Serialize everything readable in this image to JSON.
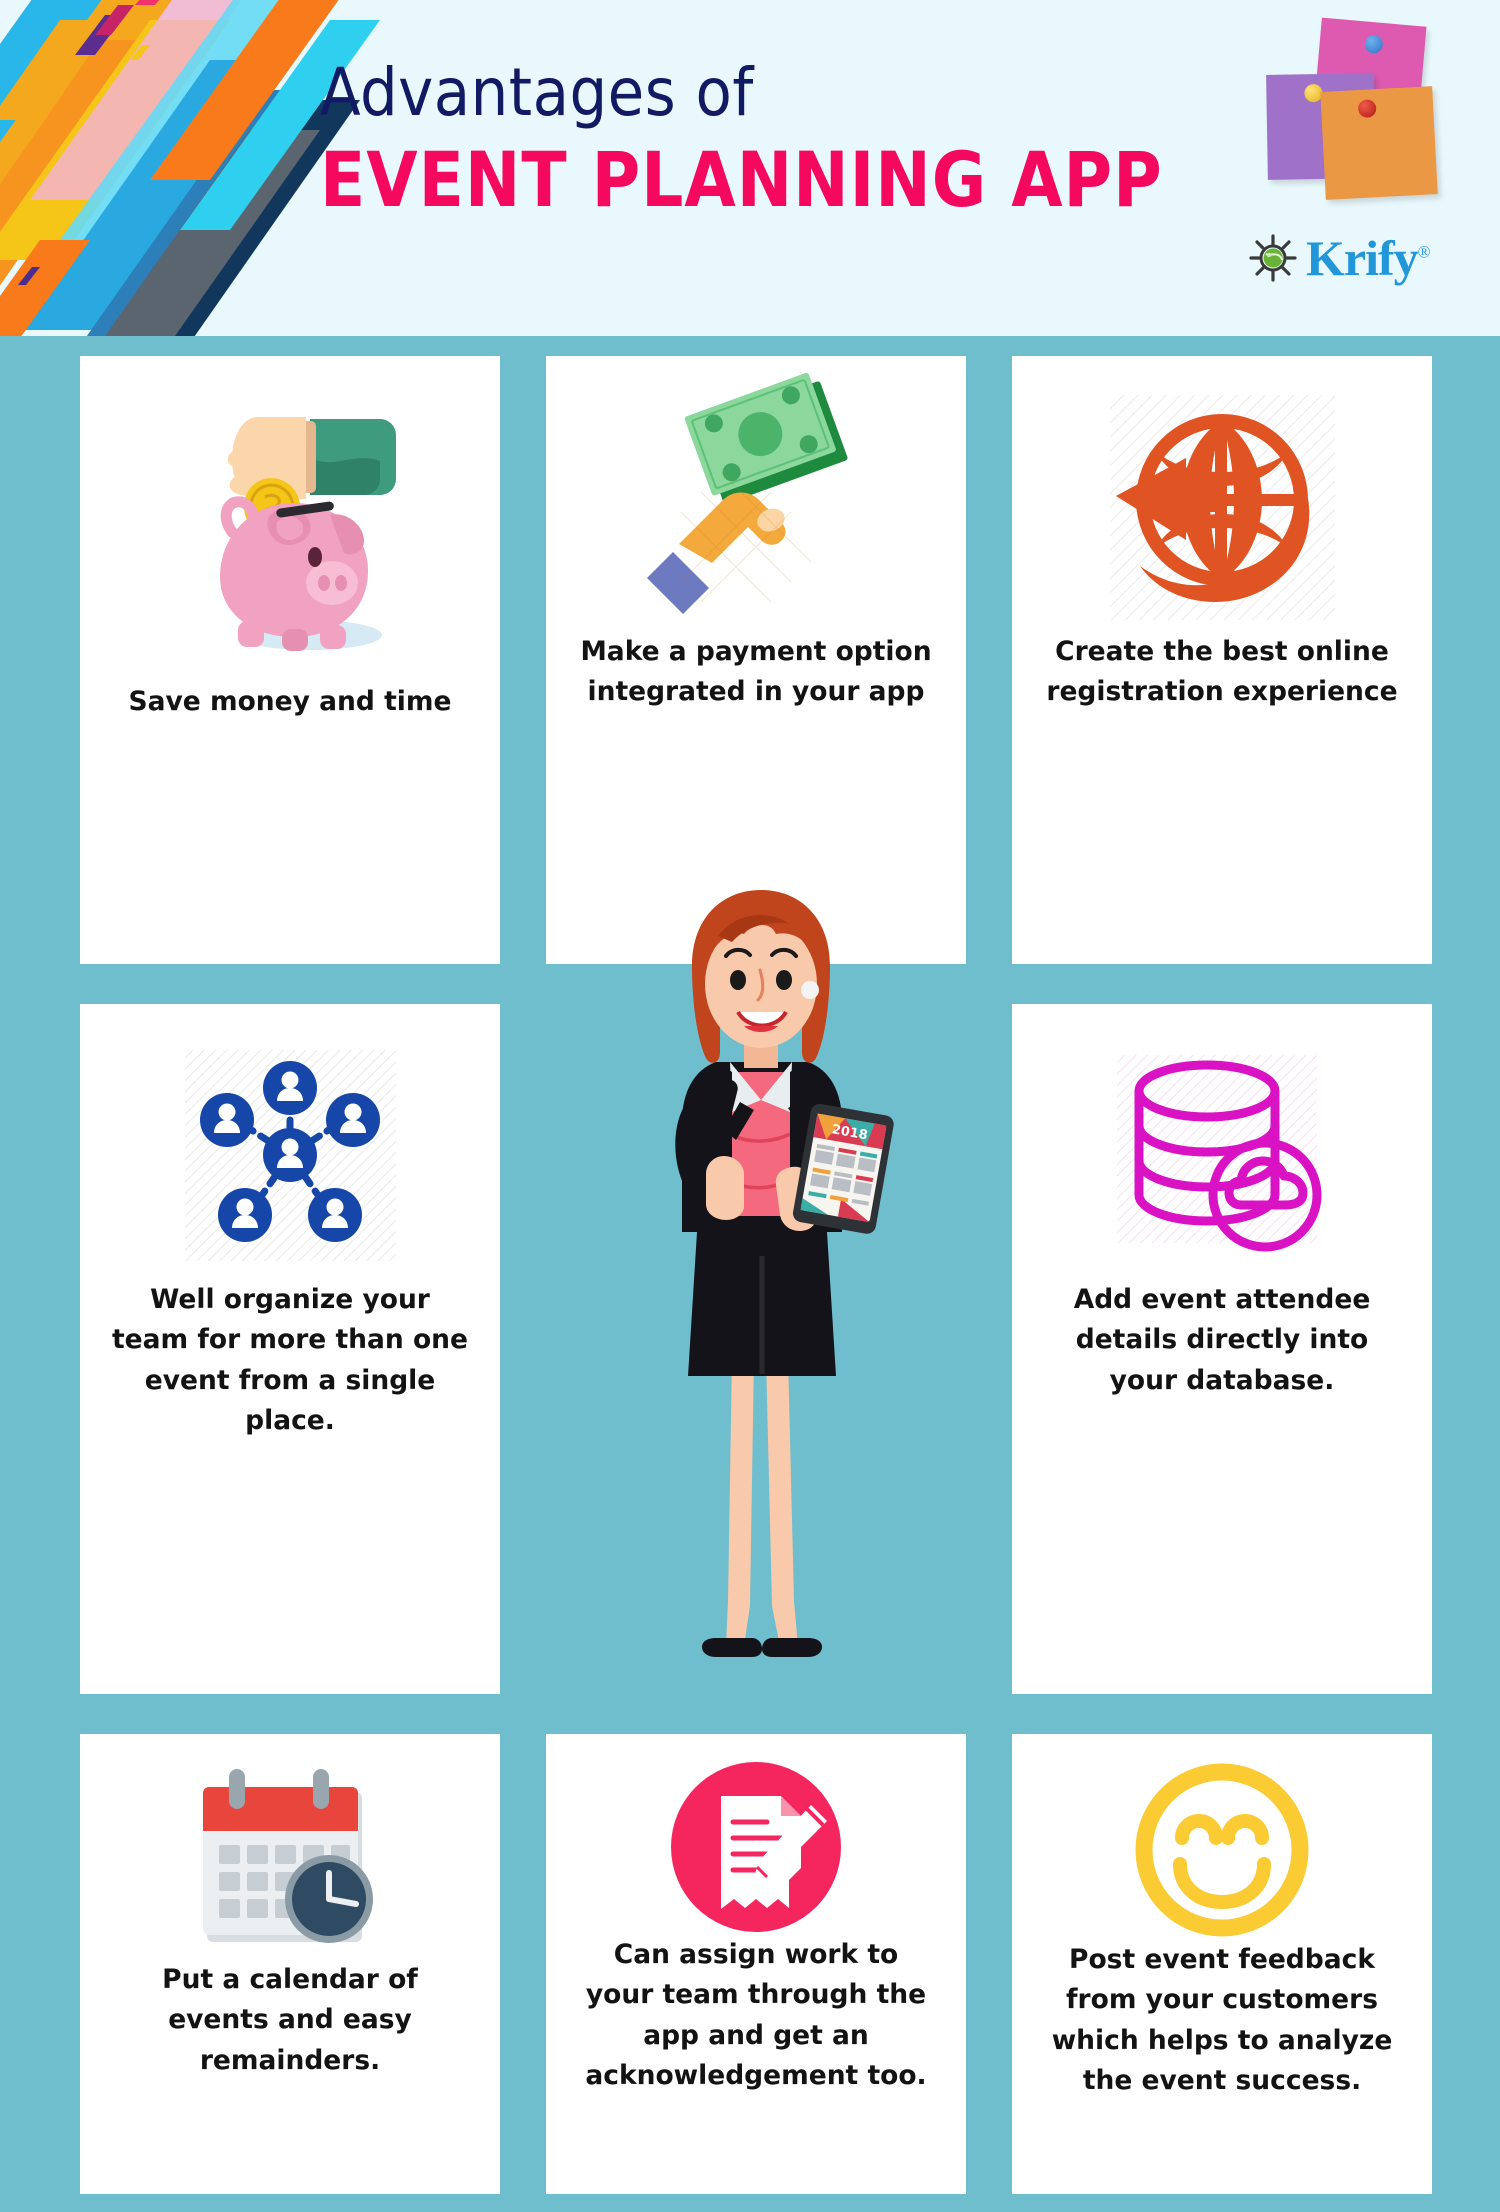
{
  "header": {
    "title_line1": "Advantages of",
    "title_line2": "EVENT PLANNING APP",
    "logo_text": "Krify",
    "logo_reg": "®",
    "colors": {
      "header_bg": "#e8f8fc",
      "title_line1": "#111a63",
      "title_line2": "#f5095e",
      "logo": "#2196d8"
    },
    "sticky_notes": [
      {
        "name": "pink-note",
        "color": "#dd5ab0",
        "pin_color": "#3f7fd1"
      },
      {
        "name": "purple-note",
        "color": "#a071c8",
        "pin_color": "#f2c829"
      },
      {
        "name": "orange-note",
        "color": "#eb9845",
        "pin_color": "#c42020"
      }
    ]
  },
  "page": {
    "background": "#6ebecd",
    "card_background": "#ffffff"
  },
  "center_illustration": {
    "name": "businesswoman-with-phone-and-tablet",
    "tablet_label": "2018",
    "hair_color": "#c1451c",
    "jacket_color": "#15131a",
    "top_color": "#f4697d",
    "skin_color": "#f9c9ab"
  },
  "cards": [
    {
      "id": "save-money",
      "icon": "piggy-bank-coin-icon",
      "icon_colors": {
        "body": "#f3a0bd",
        "coin": "#f5c518",
        "sleeve": "#43a384",
        "hand": "#fcd6ab"
      },
      "text": "Save money and time"
    },
    {
      "id": "payment-option",
      "icon": "hand-holding-cash-icon",
      "icon_colors": {
        "bill": "#8bd79c",
        "bill_dark": "#1d8a3e",
        "hand": "#f4a93c",
        "cuff": "#6e7ac0"
      },
      "text": "Make a payment option integrated in your app"
    },
    {
      "id": "online-registration",
      "icon": "globe-arrow-icon",
      "icon_colors": {
        "main": "#e05424"
      },
      "text": "Create the best online registration experience"
    },
    {
      "id": "organize-team",
      "icon": "team-network-icon",
      "icon_colors": {
        "main": "#1546a8"
      },
      "text": "Well organize your team for more than one event from a single place."
    },
    {
      "id": "attendee-database",
      "icon": "database-cloud-icon",
      "icon_colors": {
        "main": "#d913c4"
      },
      "text": "Add event attendee details directly into your database."
    },
    {
      "id": "calendar-reminders",
      "icon": "calendar-clock-icon",
      "icon_colors": {
        "header": "#e8453c",
        "body": "#eceff1",
        "cells": "#c6ced3",
        "clock": "#2e4b63",
        "clock_ring": "#8a9ba5"
      },
      "text": "Put a calendar of events and easy remainders."
    },
    {
      "id": "assign-work",
      "icon": "document-pencil-circle-icon",
      "icon_colors": {
        "circle": "#f5265e",
        "glyph": "#ffffff"
      },
      "text": "Can assign work to your team through the app and get an acknowledgement too."
    },
    {
      "id": "post-event-feedback",
      "icon": "smiley-face-icon",
      "icon_colors": {
        "main": "#fbcb34"
      },
      "text": "Post event feedback from your customers which helps to analyze the event success."
    }
  ]
}
